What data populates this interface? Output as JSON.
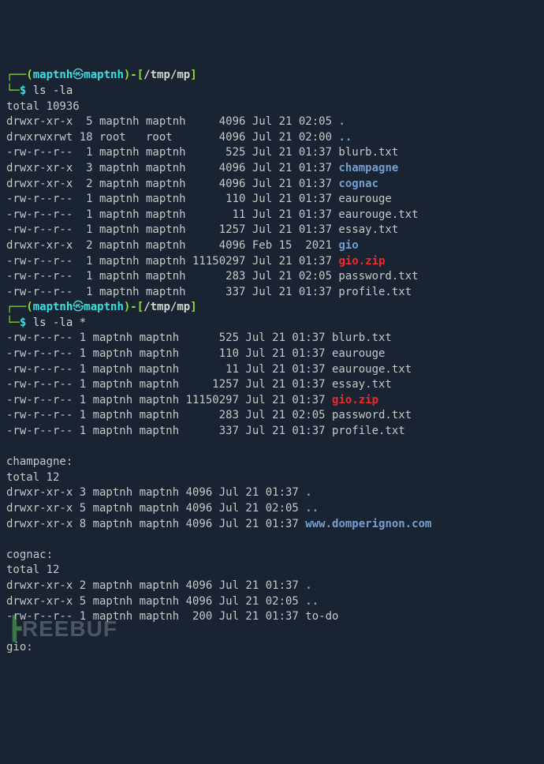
{
  "prompt1": {
    "openParen": "┌──(",
    "user": "maptnh",
    "swirl": "㉿",
    "host": "maptnh",
    "closeBracket": ")-[",
    "cwd": "/tmp/mp",
    "endBracket": "]",
    "line2prefix": "└─",
    "dollar": "$ ",
    "cmd": "ls -la"
  },
  "listing1": {
    "total": "total 10936",
    "rows": [
      {
        "perms": "drwxr-xr-x",
        "links": "5",
        "owner": "maptnh",
        "group": "maptnh",
        "size": "4096",
        "date": "Jul 21 02:05",
        "name": ".",
        "cls": "dir"
      },
      {
        "perms": "drwxrwxrwt",
        "links": "18",
        "owner": "root",
        "group": "root",
        "size": "4096",
        "date": "Jul 21 02:00",
        "name": "..",
        "cls": "dir"
      },
      {
        "perms": "-rw-r--r--",
        "links": "1",
        "owner": "maptnh",
        "group": "maptnh",
        "size": "525",
        "date": "Jul 21 01:37",
        "name": "blurb.txt",
        "cls": ""
      },
      {
        "perms": "drwxr-xr-x",
        "links": "3",
        "owner": "maptnh",
        "group": "maptnh",
        "size": "4096",
        "date": "Jul 21 01:37",
        "name": "champagne",
        "cls": "dir"
      },
      {
        "perms": "drwxr-xr-x",
        "links": "2",
        "owner": "maptnh",
        "group": "maptnh",
        "size": "4096",
        "date": "Jul 21 01:37",
        "name": "cognac",
        "cls": "dir"
      },
      {
        "perms": "-rw-r--r--",
        "links": "1",
        "owner": "maptnh",
        "group": "maptnh",
        "size": "110",
        "date": "Jul 21 01:37",
        "name": "eaurouge",
        "cls": ""
      },
      {
        "perms": "-rw-r--r--",
        "links": "1",
        "owner": "maptnh",
        "group": "maptnh",
        "size": "11",
        "date": "Jul 21 01:37",
        "name": "eaurouge.txt",
        "cls": ""
      },
      {
        "perms": "-rw-r--r--",
        "links": "1",
        "owner": "maptnh",
        "group": "maptnh",
        "size": "1257",
        "date": "Jul 21 01:37",
        "name": "essay.txt",
        "cls": ""
      },
      {
        "perms": "drwxr-xr-x",
        "links": "2",
        "owner": "maptnh",
        "group": "maptnh",
        "size": "4096",
        "date": "Feb 15  2021",
        "name": "gio",
        "cls": "dir"
      },
      {
        "perms": "-rw-r--r--",
        "links": "1",
        "owner": "maptnh",
        "group": "maptnh",
        "size": "11150297",
        "date": "Jul 21 01:37",
        "name": "gio.zip",
        "cls": "zip"
      },
      {
        "perms": "-rw-r--r--",
        "links": "1",
        "owner": "maptnh",
        "group": "maptnh",
        "size": "283",
        "date": "Jul 21 02:05",
        "name": "password.txt",
        "cls": ""
      },
      {
        "perms": "-rw-r--r--",
        "links": "1",
        "owner": "maptnh",
        "group": "maptnh",
        "size": "337",
        "date": "Jul 21 01:37",
        "name": "profile.txt",
        "cls": ""
      }
    ]
  },
  "prompt2": {
    "cmd": "ls -la *"
  },
  "listing2": {
    "rows": [
      {
        "perms": "-rw-r--r--",
        "links": "1",
        "owner": "maptnh",
        "group": "maptnh",
        "size": "525",
        "date": "Jul 21 01:37",
        "name": "blurb.txt",
        "cls": ""
      },
      {
        "perms": "-rw-r--r--",
        "links": "1",
        "owner": "maptnh",
        "group": "maptnh",
        "size": "110",
        "date": "Jul 21 01:37",
        "name": "eaurouge",
        "cls": ""
      },
      {
        "perms": "-rw-r--r--",
        "links": "1",
        "owner": "maptnh",
        "group": "maptnh",
        "size": "11",
        "date": "Jul 21 01:37",
        "name": "eaurouge.txt",
        "cls": ""
      },
      {
        "perms": "-rw-r--r--",
        "links": "1",
        "owner": "maptnh",
        "group": "maptnh",
        "size": "1257",
        "date": "Jul 21 01:37",
        "name": "essay.txt",
        "cls": ""
      },
      {
        "perms": "-rw-r--r--",
        "links": "1",
        "owner": "maptnh",
        "group": "maptnh",
        "size": "11150297",
        "date": "Jul 21 01:37",
        "name": "gio.zip",
        "cls": "zip"
      },
      {
        "perms": "-rw-r--r--",
        "links": "1",
        "owner": "maptnh",
        "group": "maptnh",
        "size": "283",
        "date": "Jul 21 02:05",
        "name": "password.txt",
        "cls": ""
      },
      {
        "perms": "-rw-r--r--",
        "links": "1",
        "owner": "maptnh",
        "group": "maptnh",
        "size": "337",
        "date": "Jul 21 01:37",
        "name": "profile.txt",
        "cls": ""
      }
    ],
    "champagne": {
      "header": "champagne:",
      "total": "total 12",
      "rows": [
        {
          "perms": "drwxr-xr-x",
          "links": "3",
          "owner": "maptnh",
          "group": "maptnh",
          "size": "4096",
          "date": "Jul 21 01:37",
          "name": ".",
          "cls": "dir"
        },
        {
          "perms": "drwxr-xr-x",
          "links": "5",
          "owner": "maptnh",
          "group": "maptnh",
          "size": "4096",
          "date": "Jul 21 02:05",
          "name": "..",
          "cls": "dir"
        },
        {
          "perms": "drwxr-xr-x",
          "links": "8",
          "owner": "maptnh",
          "group": "maptnh",
          "size": "4096",
          "date": "Jul 21 01:37",
          "name": "www.domperignon.com",
          "cls": "dir"
        }
      ]
    },
    "cognac": {
      "header": "cognac:",
      "total": "total 12",
      "rows": [
        {
          "perms": "drwxr-xr-x",
          "links": "2",
          "owner": "maptnh",
          "group": "maptnh",
          "size": "4096",
          "date": "Jul 21 01:37",
          "name": ".",
          "cls": "dir"
        },
        {
          "perms": "drwxr-xr-x",
          "links": "5",
          "owner": "maptnh",
          "group": "maptnh",
          "size": "4096",
          "date": "Jul 21 02:05",
          "name": "..",
          "cls": "dir"
        },
        {
          "perms": "-rw-r--r--",
          "links": "1",
          "owner": "maptnh",
          "group": "maptnh",
          "size": "200",
          "date": "Jul 21 01:37",
          "name": "to-do",
          "cls": ""
        }
      ]
    },
    "gio": {
      "header": "gio:"
    }
  },
  "watermark": "REEBUF"
}
